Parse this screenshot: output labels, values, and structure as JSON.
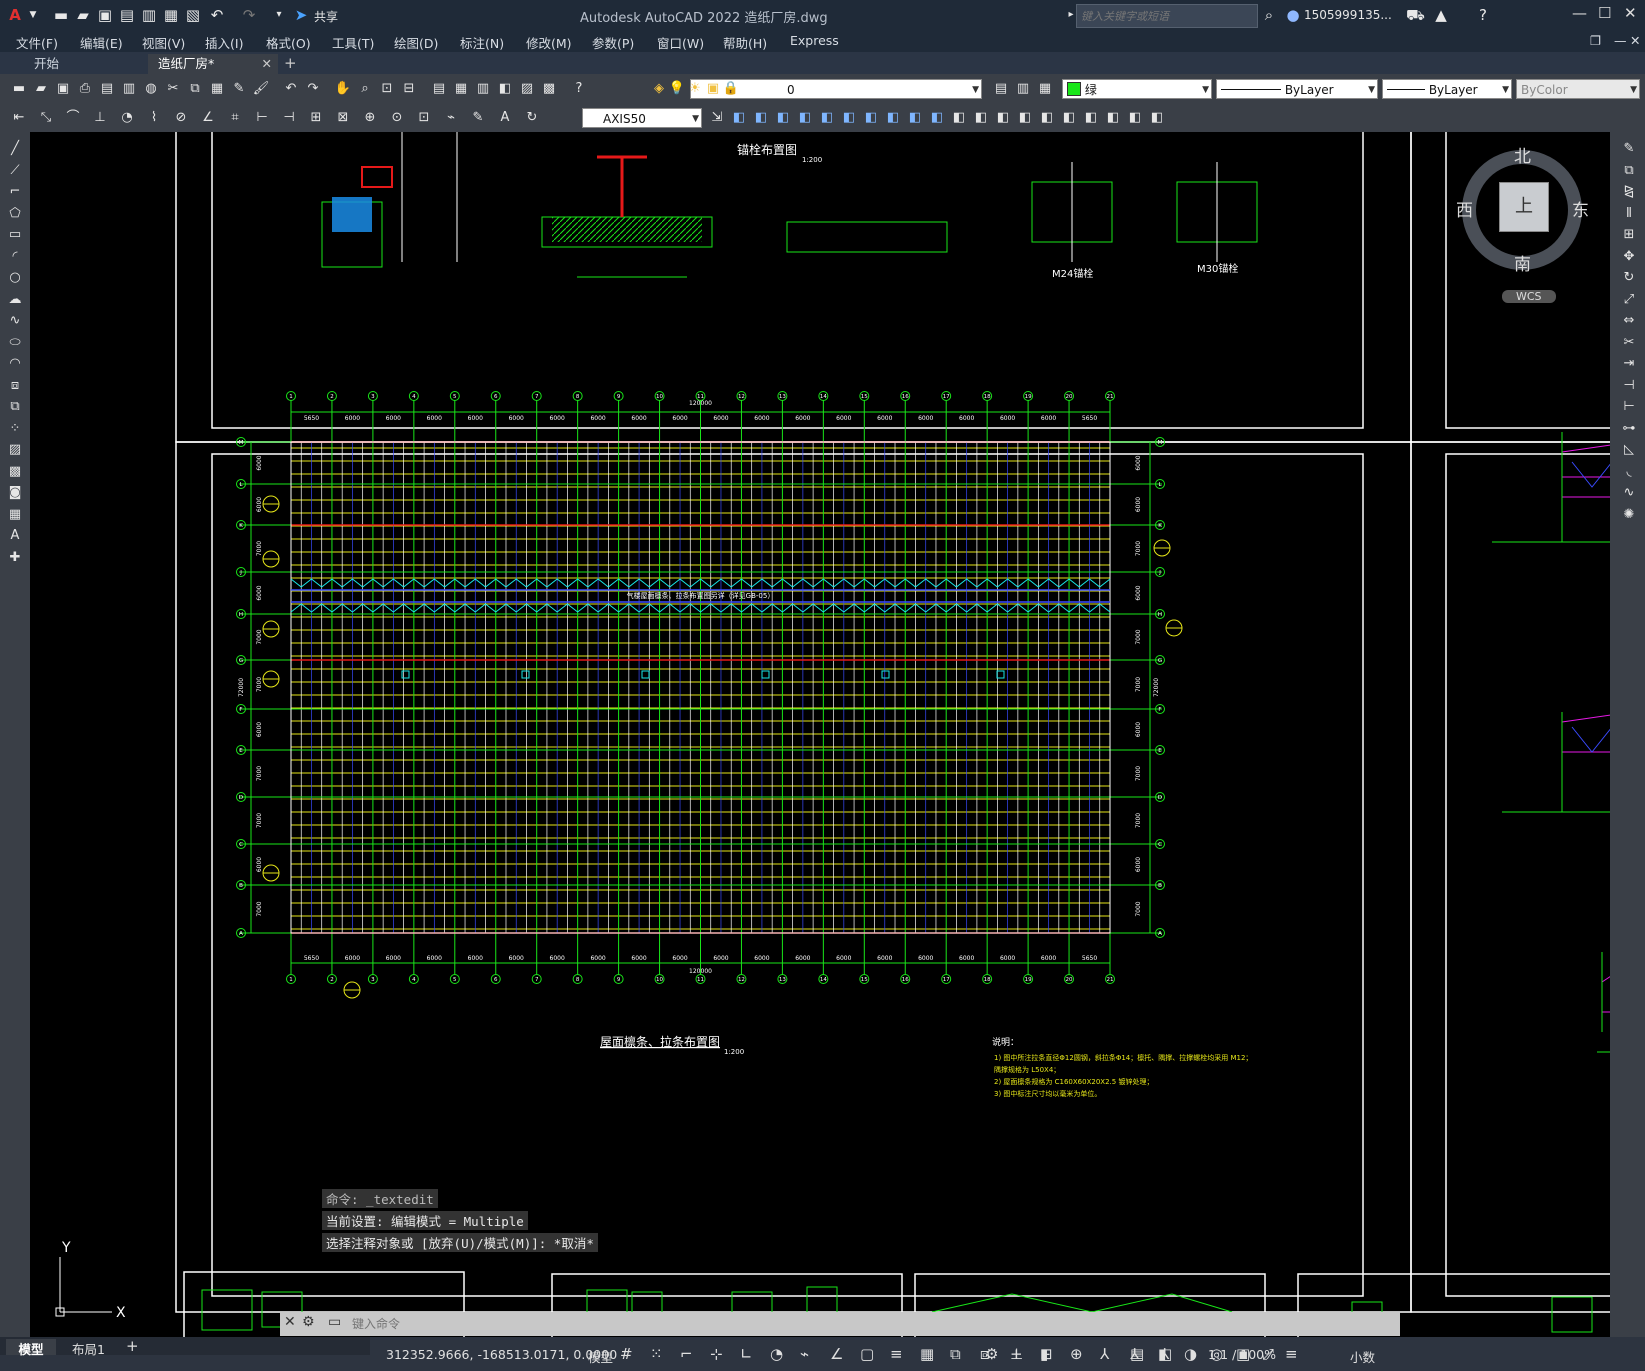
{
  "app": {
    "title": "Autodesk AutoCAD 2022    造纸厂房.dwg",
    "search_placeholder": "键入关键字或短语",
    "user": "1505999135...",
    "share_label": "共享",
    "logo": "A"
  },
  "menu": [
    "文件(F)",
    "编辑(E)",
    "视图(V)",
    "插入(I)",
    "格式(O)",
    "工具(T)",
    "绘图(D)",
    "标注(N)",
    "修改(M)",
    "参数(P)",
    "窗口(W)",
    "帮助(H)",
    "Express"
  ],
  "tabs": [
    {
      "label": "开始",
      "active": false
    },
    {
      "label": "造纸厂房*",
      "active": true
    }
  ],
  "toolbar": {
    "layer_value": "0",
    "color_value": "绿",
    "linetype_value": "ByLayer",
    "lineweight_value": "ByLayer",
    "plotstyle_value": "ByColor",
    "dimstyle_value": "AXIS50"
  },
  "viewcube": {
    "north": "北",
    "south": "南",
    "west": "西",
    "east": "东",
    "top": "上",
    "wcs": "WCS"
  },
  "drawing": {
    "anchor_title": "锚栓布置图",
    "anchor_scale": "1:200",
    "m24_label": "M24锚栓",
    "m30_label": "M30锚栓",
    "plan_title": "屋面檩条、拉条布置图",
    "plan_scale": "1:200",
    "band_text": "气楼屋面檩条、拉条布置图另详（详见GB-05）",
    "notes_title": "说明：",
    "notes": [
      "1) 图中所注拉条直径Φ12圆钢，斜拉条Φ14；檩托、隅撑、拉撑螺栓均采用 M12；",
      "   隅撑规格为 L50X4；",
      "2) 屋面檩条规格为 C160X60X20X2.5 镀锌处理；",
      "3) 图中标注尺寸均以毫米为单位。"
    ],
    "total_dim": "120000",
    "total_dim_v": "72000",
    "col_axis_labels": [
      "1",
      "2",
      "3",
      "4",
      "5",
      "6",
      "7",
      "8",
      "9",
      "10",
      "11",
      "12",
      "13",
      "14",
      "15",
      "16",
      "17",
      "18",
      "19",
      "20",
      "21"
    ],
    "row_axis_labels": [
      "M",
      "L",
      "K",
      "J",
      "H",
      "G",
      "F",
      "E",
      "D",
      "C",
      "B",
      "A"
    ],
    "bay_dims": [
      "5650",
      "6000",
      "6000",
      "6000",
      "6000",
      "6000",
      "6000",
      "6000",
      "6000",
      "6000",
      "6000",
      "6000",
      "6000",
      "6000",
      "6000",
      "6000",
      "6000",
      "6000",
      "6000",
      "5650"
    ],
    "row_dims": [
      "6000",
      "6000",
      "7000",
      "6000",
      "7000",
      "7000",
      "6000",
      "7000",
      "7000",
      "6000",
      "7000"
    ],
    "row_dims_right": [
      "6000",
      "6000",
      "7000",
      "6000",
      "7000",
      "7000",
      "6000",
      "7000",
      "7000",
      "6000",
      "7000"
    ],
    "ucs_x": "X",
    "ucs_y": "Y"
  },
  "command": {
    "history": [
      "命令: _textedit",
      "当前设置: 编辑模式 = Multiple",
      "选择注释对象或 [放弃(U)/模式(M)]: *取消*"
    ],
    "placeholder": "键入命令"
  },
  "layout_tabs": [
    "模型",
    "布局1"
  ],
  "status": {
    "coords": "312352.9666, -168513.0171, 0.0000",
    "mode": "模型",
    "scale": "1:1 / 100%",
    "units": "小数"
  },
  "colors": {
    "green": "#19e619",
    "yellow": "#e6e619",
    "red": "#e61919",
    "blue": "#3a4bff",
    "cyan": "#19e6e6",
    "magenta": "#e619e6",
    "white": "#ffffff"
  }
}
